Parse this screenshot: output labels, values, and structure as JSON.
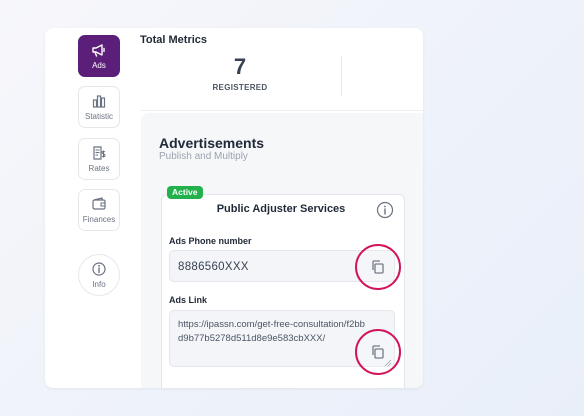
{
  "sidebar": {
    "items": [
      {
        "label": "Ads",
        "icon": "megaphone-icon",
        "active": true
      },
      {
        "label": "Statistic",
        "icon": "bar-chart-icon"
      },
      {
        "label": "Rates",
        "icon": "invoice-dollar-icon"
      },
      {
        "label": "Finances",
        "icon": "wallet-icon"
      },
      {
        "label": "Info",
        "icon": "info-circle-icon"
      }
    ]
  },
  "metrics": {
    "title": "Total Metrics",
    "value": "7",
    "label": "REGISTERED"
  },
  "ads": {
    "title": "Advertisements",
    "subtitle": "Publish and Multiply",
    "card": {
      "status": "Active",
      "name": "Public Adjuster Services",
      "phone_label": "Ads Phone number",
      "phone_value": "8886560XXX",
      "link_label": "Ads Link",
      "link_value": "https://ipassn.com/get-free-consultation/f2bbd9b77b5278d511d8e9e583cbXXX/"
    }
  },
  "colors": {
    "accent": "#5b1f7a",
    "active_badge": "#22b14c",
    "highlight": "#d2145a"
  }
}
